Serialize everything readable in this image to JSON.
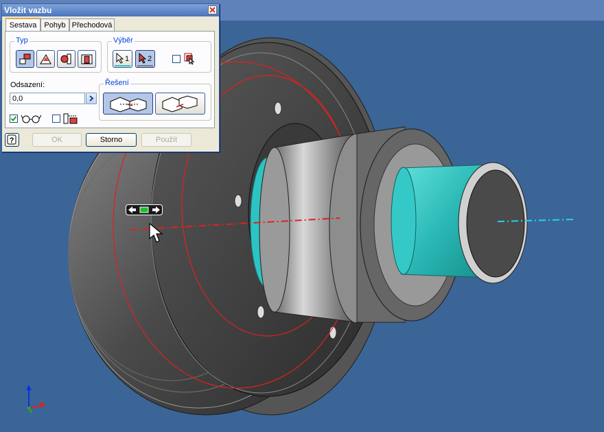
{
  "dialog": {
    "title": "Vložit vazbu",
    "tabs": [
      {
        "label": "Sestava",
        "active": true
      },
      {
        "label": "Pohyb",
        "active": false
      },
      {
        "label": "Přechodová",
        "active": false
      }
    ],
    "type_group": {
      "label": "Typ",
      "selected": 0,
      "buttons": [
        "mate-constraint-icon",
        "angle-constraint-icon",
        "tangent-constraint-icon",
        "insert-constraint-icon"
      ]
    },
    "selection_group": {
      "label": "Výběr",
      "first": "1",
      "second": "2",
      "pick_part_first_checked": false
    },
    "offset": {
      "label": "Odsazení:",
      "value": "0,0"
    },
    "preview_checked": true,
    "predict_offset_checked": false,
    "solution_group": {
      "label": "Řešení",
      "selected": 0
    },
    "buttons": {
      "ok": "OK",
      "cancel": "Storno",
      "apply": "Použít"
    }
  },
  "colors": {
    "background": "#3b6596",
    "title_bar": "#4a74bc",
    "selection_highlight": "#2ec3c3",
    "constraint_line": "#e02020",
    "axis_preview": "#22d4ee"
  }
}
